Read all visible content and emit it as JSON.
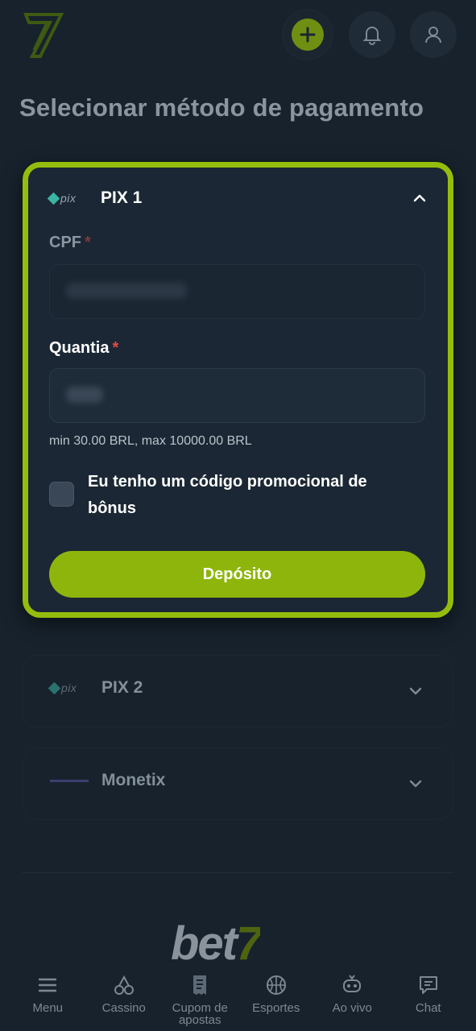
{
  "header": {
    "logo_alt": "7",
    "add_icon": "plus-icon",
    "bell_icon": "bell-icon",
    "user_icon": "user-icon"
  },
  "page_title": "Selecionar método de pagamento",
  "active_method": {
    "logo_text": "pix",
    "title": "PIX 1",
    "cpf": {
      "label": "CPF",
      "required_mark": "*"
    },
    "amount": {
      "label": "Quantia",
      "required_mark": "*"
    },
    "hint": "min 30.00 BRL, max 10000.00 BRL",
    "promo_checkbox_label": "Eu tenho um código promocional de bônus",
    "submit_label": "Depósito"
  },
  "other_methods": [
    {
      "title": "PIX 2",
      "logo": "pix"
    },
    {
      "title": "Monetix",
      "logo": "monetix"
    }
  ],
  "footer_brand": {
    "text": "bet",
    "accent": "7"
  },
  "bottom_nav": [
    {
      "label": "Menu",
      "icon": "menu-icon"
    },
    {
      "label": "Cassino",
      "icon": "cherries-icon"
    },
    {
      "label": "Cupom de apostas",
      "icon": "receipt-icon"
    },
    {
      "label": "Esportes",
      "icon": "basketball-icon"
    },
    {
      "label": "Ao vivo",
      "icon": "live-icon"
    },
    {
      "label": "Chat",
      "icon": "chat-icon"
    }
  ],
  "colors": {
    "accent": "#8eb50b",
    "background": "#17222d",
    "card": "#1b2734",
    "required": "#e24a4a"
  }
}
